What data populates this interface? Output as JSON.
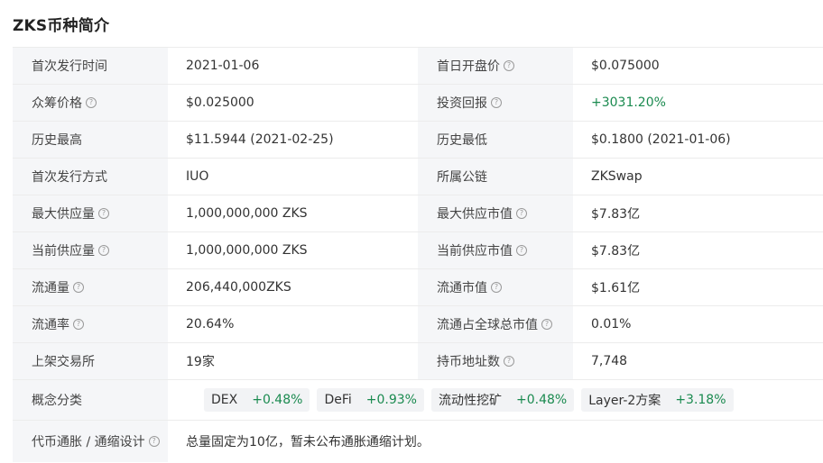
{
  "title": "ZKS币种简介",
  "rows": [
    {
      "l1": "首次发行时间",
      "v1": "2021-01-06",
      "l2": "首日开盘价",
      "v2": "$0.075000"
    },
    {
      "l1": "众筹价格",
      "v1": "$0.025000",
      "l2": "投资回报",
      "v2": "+3031.20%"
    },
    {
      "l1": "历史最高",
      "v1": "$11.5944 (2021-02-25)",
      "l2": "历史最低",
      "v2": "$0.1800 (2021-01-06)"
    },
    {
      "l1": "首次发行方式",
      "v1": "IUO",
      "l2": "所属公链",
      "v2": "ZKSwap"
    },
    {
      "l1": "最大供应量",
      "v1": "1,000,000,000 ZKS",
      "l2": "最大供应市值",
      "v2": "$7.83亿"
    },
    {
      "l1": "当前供应量",
      "v1": "1,000,000,000 ZKS",
      "l2": "当前供应市值",
      "v2": "$7.83亿"
    },
    {
      "l1": "流通量",
      "v1": "206,440,000ZKS",
      "l2": "流通市值",
      "v2": "$1.61亿"
    },
    {
      "l1": "流通率",
      "v1": "20.64%",
      "l2": "流通占全球总市值",
      "v2": "0.01%"
    },
    {
      "l1": "上架交易所",
      "v1": "19家",
      "l2": "持币地址数",
      "v2": "7,748"
    }
  ],
  "concept": {
    "label": "概念分类",
    "tags": [
      {
        "name": "DEX",
        "change": "+0.48%"
      },
      {
        "name": "DeFi",
        "change": "+0.93%"
      },
      {
        "name": "流动性挖矿",
        "change": "+0.48%"
      },
      {
        "name": "Layer-2方案",
        "change": "+3.18%"
      }
    ]
  },
  "inflation": {
    "label": "代币通胀 / 通缩设计",
    "text": "总量固定为10亿，暂未公布通胀通缩计划。"
  },
  "help_glyph": "?",
  "colors": {
    "positive": "#1a8a4f",
    "label_bg": "#f5f6f8",
    "border": "#ececec"
  }
}
